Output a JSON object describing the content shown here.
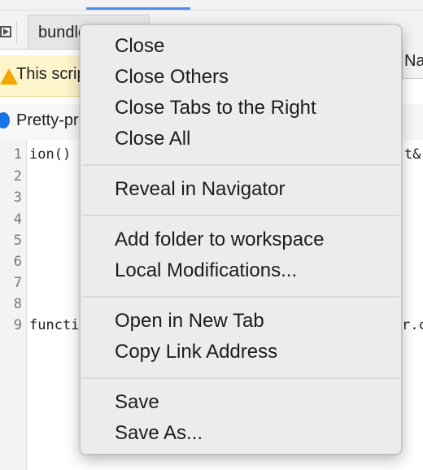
{
  "background": {
    "file_tab_label": "bundle.js",
    "right_tab_label": "Na",
    "warning_text": "This script is blackboxed in debugger",
    "info_text": "Pretty-print this minified file?",
    "line_numbers": [
      "1",
      "2",
      "3",
      "4",
      "5",
      "6",
      "7",
      "8",
      "9"
    ],
    "code_line_1_left": "ion()",
    "code_line_1_right": "t&",
    "code_line_9_left": "functi",
    "code_line_9_right": "r.c"
  },
  "menu": {
    "groups": [
      [
        "Close",
        "Close Others",
        "Close Tabs to the Right",
        "Close All"
      ],
      [
        "Reveal in Navigator"
      ],
      [
        "Add folder to workspace",
        "Local Modifications..."
      ],
      [
        "Open in New Tab",
        "Copy Link Address"
      ],
      [
        "Save",
        "Save As..."
      ]
    ]
  },
  "colors": {
    "menu_bg": "#ececec",
    "warning_bg": "#fff5cc",
    "accent": "#4a8cf0",
    "info_icon": "#1a73e8",
    "warn_icon": "#f2a600"
  }
}
